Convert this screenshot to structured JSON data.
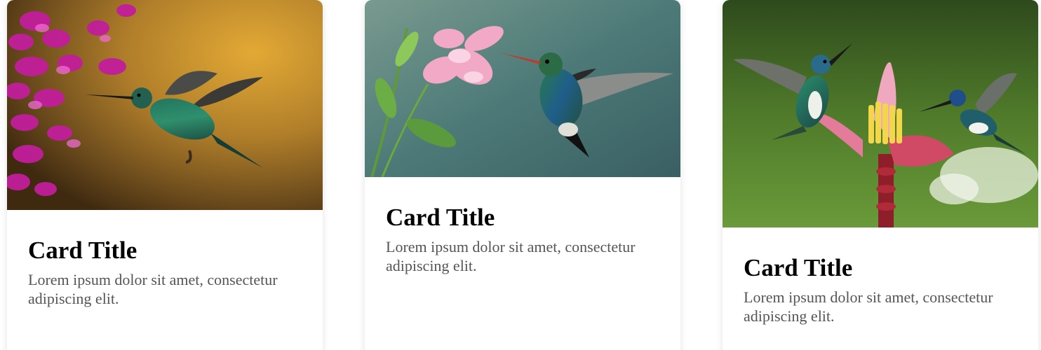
{
  "cards": [
    {
      "image_subject": "hummingbird-by-magenta-flowers",
      "title": "Card Title",
      "text": "Lorem ipsum dolor sit amet, consectetur adipiscing elit."
    },
    {
      "image_subject": "hummingbird-by-pink-flower",
      "title": "Card Title",
      "text": "Lorem ipsum dolor sit amet, consectetur adipiscing elit."
    },
    {
      "image_subject": "two-hummingbirds-by-banana-flower",
      "title": "Card Title",
      "text": "Lorem ipsum dolor sit amet, consectetur adipiscing elit."
    }
  ],
  "colors": {
    "title": "#000000",
    "body_text": "#555555",
    "card_background": "#ffffff"
  }
}
